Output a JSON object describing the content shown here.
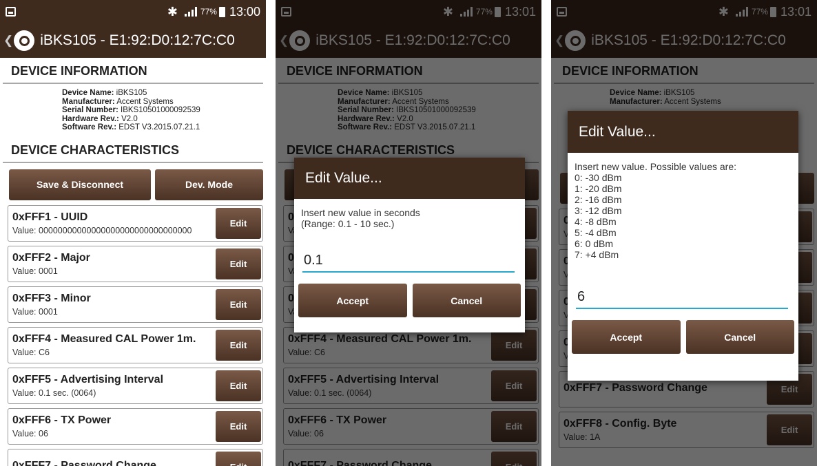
{
  "status_bars": [
    {
      "time": "13:00"
    },
    {
      "time": "13:01"
    },
    {
      "time": "13:01"
    }
  ],
  "status_common": {
    "battery": "77%"
  },
  "app": {
    "title": "iBKS105 - E1:92:D0:12:7C:C0"
  },
  "device_info": {
    "heading": "DEVICE INFORMATION",
    "lines": [
      {
        "label": "Device Name:",
        "value": " iBKS105"
      },
      {
        "label": "Manufacturer:",
        "value": " Accent Systems"
      },
      {
        "label": "Serial Number:",
        "value": " IBKS10501000092539"
      },
      {
        "label": "Hardware Rev.:",
        "value": " V2.0"
      },
      {
        "label": "Software Rev.:",
        "value": " EDST V3.2015.07.21.1"
      }
    ]
  },
  "characteristics": {
    "heading": "DEVICE CHARACTERISTICS",
    "save_label": "Save & Disconnect",
    "devmode_label": "Dev. Mode",
    "edit_label": "Edit",
    "items": [
      {
        "title": "0xFFF1 - UUID",
        "value": "Value: 00000000000000000000000000000000"
      },
      {
        "title": "0xFFF2 - Major",
        "value": "Value: 0001"
      },
      {
        "title": "0xFFF3 - Minor",
        "value": "Value: 0001"
      },
      {
        "title": "0xFFF4 - Measured CAL Power 1m.",
        "value": "Value: C6"
      },
      {
        "title": "0xFFF5 - Advertising Interval",
        "value": "Value: 0.1 sec. (0064)"
      },
      {
        "title": "0xFFF6 - TX Power",
        "value": "Value: 06"
      },
      {
        "title": "0xFFF7 - Password Change",
        "value": ""
      },
      {
        "title": "0xFFF8 - Config. Byte",
        "value": "Value: 1A"
      }
    ]
  },
  "dialog_interval": {
    "title": "Edit Value...",
    "message_lines": [
      "Insert new value in seconds",
      "(Range: 0.1 - 10 sec.)"
    ],
    "value": "0.1",
    "accept_label": "Accept",
    "cancel_label": "Cancel"
  },
  "dialog_txpower": {
    "title": "Edit Value...",
    "message_lines": [
      "Insert new value. Possible values are:",
      "0: -30 dBm",
      "1: -20 dBm",
      "2: -16 dBm",
      "3: -12 dBm",
      "4: -8 dBm",
      "5: -4 dBm",
      "6: 0 dBm",
      "7: +4 dBm"
    ],
    "value": "6",
    "accept_label": "Accept",
    "cancel_label": "Cancel"
  }
}
